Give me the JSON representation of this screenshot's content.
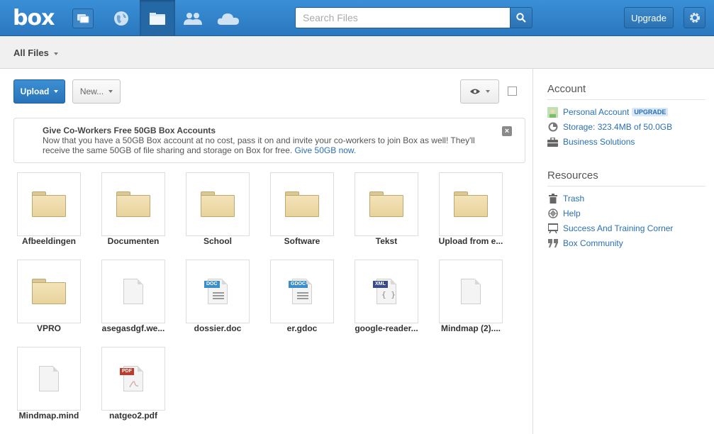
{
  "header": {
    "logo": "box",
    "search_placeholder": "Search Files",
    "upgrade_label": "Upgrade",
    "nav_icons": [
      "updates-icon",
      "globe-icon",
      "folder-icon",
      "users-icon",
      "cloud-icon"
    ],
    "accent": "#2a78bf"
  },
  "subheader": {
    "title": "All Files"
  },
  "toolbar": {
    "upload_label": "Upload",
    "new_label": "New..."
  },
  "banner": {
    "title": "Give Co-Workers Free 50GB Box Accounts",
    "line1": "Now that you have a 50GB Box account at no cost, pass it on and invite your co-workers to join Box as well! They'll",
    "line2": "receive the same 50GB of file sharing and storage on Box for free.",
    "link": "Give 50GB now.",
    "close": "×"
  },
  "files": [
    {
      "name": "Afbeeldingen",
      "kind": "folder"
    },
    {
      "name": "Documenten",
      "kind": "folder"
    },
    {
      "name": "School",
      "kind": "folder"
    },
    {
      "name": "Software",
      "kind": "folder"
    },
    {
      "name": "Tekst",
      "kind": "folder"
    },
    {
      "name": "Upload from e...",
      "kind": "folder"
    },
    {
      "name": "VPRO",
      "kind": "folder"
    },
    {
      "name": "asegasdgf.we...",
      "kind": "file"
    },
    {
      "name": "dossier.doc",
      "kind": "doc",
      "tag": "DOC",
      "tag_color": "#3b8ec9"
    },
    {
      "name": "er.gdoc",
      "kind": "doc",
      "tag": "GDOC",
      "tag_color": "#3b8ec9"
    },
    {
      "name": "google-reader...",
      "kind": "xml",
      "tag": "XML",
      "tag_color": "#3a4a8f"
    },
    {
      "name": "Mindmap (2)....",
      "kind": "file"
    },
    {
      "name": "Mindmap.mind",
      "kind": "file"
    },
    {
      "name": "natgeo2.pdf",
      "kind": "pdf",
      "tag": "PDF",
      "tag_color": "#c0392b"
    }
  ],
  "sidebar": {
    "account_title": "Account",
    "account_items": [
      {
        "label": "Personal Account",
        "badge": "UPGRADE",
        "icon": "avatar-icon"
      },
      {
        "label": "Storage: 323.4MB of 50.0GB",
        "icon": "storage-pie-icon"
      },
      {
        "label": "Business Solutions",
        "icon": "briefcase-icon"
      }
    ],
    "resources_title": "Resources",
    "resource_items": [
      {
        "label": "Trash",
        "icon": "trash-icon"
      },
      {
        "label": "Help",
        "icon": "help-lifebuoy-icon"
      },
      {
        "label": "Success And Training Corner",
        "icon": "training-board-icon"
      },
      {
        "label": "Box Community",
        "icon": "quote-icon"
      }
    ]
  }
}
